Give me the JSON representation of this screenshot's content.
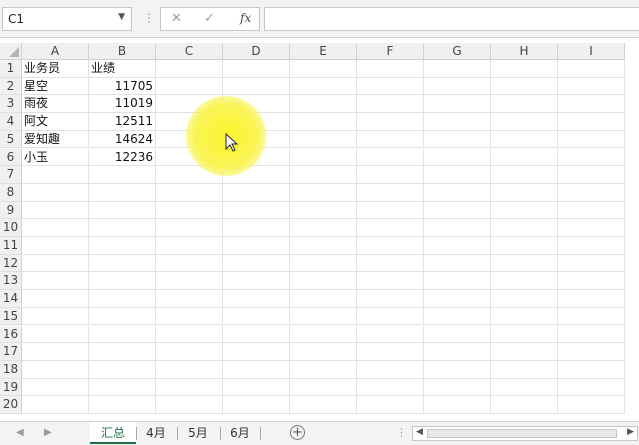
{
  "formula_bar": {
    "name_box": "C1",
    "separator": "⋮",
    "cancel_glyph": "✕",
    "enter_glyph": "✓",
    "fx_label": "fx",
    "formula_value": ""
  },
  "columns": [
    "A",
    "B",
    "C",
    "D",
    "E",
    "F",
    "G",
    "H",
    "I"
  ],
  "rows": [
    "1",
    "2",
    "3",
    "4",
    "5",
    "6",
    "7",
    "8",
    "9",
    "10",
    "11",
    "12",
    "13",
    "14",
    "15",
    "16",
    "17",
    "18",
    "19",
    "20"
  ],
  "cells": {
    "A1": "业务员",
    "B1": "业绩",
    "A2": "星空",
    "B2": "11705",
    "A3": "雨夜",
    "B3": "11019",
    "A4": "阿文",
    "B4": "12511",
    "A5": "爱知趣",
    "B5": "14624",
    "A6": "小玉",
    "B6": "12236"
  },
  "sheet_tabs": [
    {
      "label": "汇总",
      "active": true
    },
    {
      "label": "4月",
      "active": false
    },
    {
      "label": "5月",
      "active": false
    },
    {
      "label": "6月",
      "active": false
    }
  ],
  "tab_nav": {
    "prev": "◀",
    "next": "▶",
    "add": "+",
    "dots": "⋮"
  },
  "hscroll": {
    "left": "◀",
    "right": "▶"
  },
  "colors": {
    "accent": "#1e7145",
    "highlight": "#fbf62e"
  },
  "icons": [
    "name-box-dropdown-icon",
    "cancel-icon",
    "enter-icon",
    "insert-function-icon",
    "add-sheet-icon",
    "mouse-cursor-icon"
  ]
}
